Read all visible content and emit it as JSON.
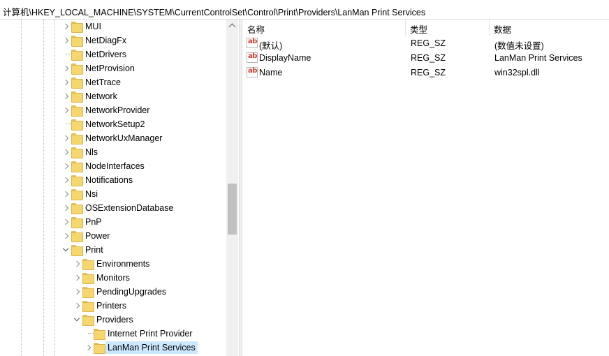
{
  "address_bar": {
    "path": "计算机\\HKEY_LOCAL_MACHINE\\SYSTEM\\CurrentControlSet\\Control\\Print\\Providers\\LanMan Print Services"
  },
  "tree": {
    "items": [
      {
        "label": "MUI",
        "state": "collapsed"
      },
      {
        "label": "NetDiagFx",
        "state": "collapsed"
      },
      {
        "label": "NetDrivers",
        "state": "leaf"
      },
      {
        "label": "NetProvision",
        "state": "collapsed"
      },
      {
        "label": "NetTrace",
        "state": "collapsed"
      },
      {
        "label": "Network",
        "state": "collapsed"
      },
      {
        "label": "NetworkProvider",
        "state": "collapsed"
      },
      {
        "label": "NetworkSetup2",
        "state": "leaf"
      },
      {
        "label": "NetworkUxManager",
        "state": "collapsed"
      },
      {
        "label": "Nls",
        "state": "collapsed"
      },
      {
        "label": "NodeInterfaces",
        "state": "collapsed"
      },
      {
        "label": "Notifications",
        "state": "collapsed"
      },
      {
        "label": "Nsi",
        "state": "collapsed"
      },
      {
        "label": "OSExtensionDatabase",
        "state": "collapsed"
      },
      {
        "label": "PnP",
        "state": "collapsed"
      },
      {
        "label": "Power",
        "state": "collapsed"
      },
      {
        "label": "Print",
        "state": "expanded"
      },
      {
        "label": "Environments",
        "state": "collapsed"
      },
      {
        "label": "Monitors",
        "state": "collapsed"
      },
      {
        "label": "PendingUpgrades",
        "state": "collapsed"
      },
      {
        "label": "Printers",
        "state": "collapsed"
      },
      {
        "label": "Providers",
        "state": "expanded"
      },
      {
        "label": "Internet Print Provider",
        "state": "leaf"
      },
      {
        "label": "LanMan Print Services",
        "state": "collapsed",
        "selected": true
      }
    ]
  },
  "list": {
    "headers": {
      "name": "名称",
      "type": "类型",
      "data": "数据"
    },
    "rows": [
      {
        "icon": "ab",
        "name": "(默认)",
        "type": "REG_SZ",
        "data": "(数值未设置)"
      },
      {
        "icon": "ab",
        "name": "DisplayName",
        "type": "REG_SZ",
        "data": "LanMan Print Services"
      },
      {
        "icon": "ab",
        "name": "Name",
        "type": "REG_SZ",
        "data": "win32spl.dll"
      }
    ]
  }
}
